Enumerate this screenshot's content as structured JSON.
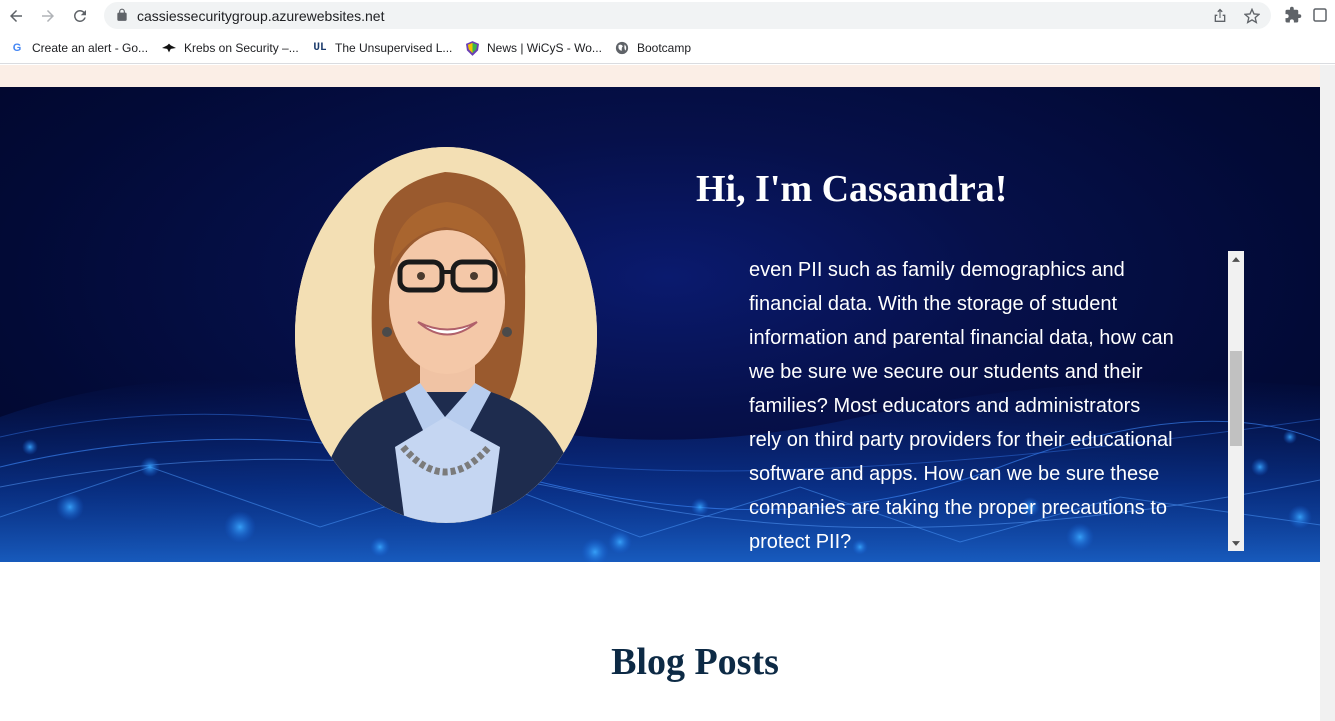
{
  "browser": {
    "url": "cassiessecuritygroup.azurewebsites.net"
  },
  "bookmarks": [
    {
      "label": "Create an alert - Go...",
      "icon": "google-icon"
    },
    {
      "label": "Krebs on Security –...",
      "icon": "krebs-icon"
    },
    {
      "label": "The Unsupervised L...",
      "icon": "unsupervised-learning-icon"
    },
    {
      "label": "News | WiCyS - Wo...",
      "icon": "wicys-shield-icon"
    },
    {
      "label": "Bootcamp",
      "icon": "globe-icon"
    }
  ],
  "hero": {
    "title": "Hi, I'm Cassandra!",
    "lines": [
      "even PII such as family demographics and",
      "financial data. With the storage of student",
      "information and parental financial data, how can",
      "we be sure we secure our students and their",
      "families? Most educators and administrators",
      "rely on third party providers for their educational",
      "software and apps. How can we be sure these",
      "companies are taking the proper precautions to",
      "protect PII?"
    ]
  },
  "blog": {
    "title": "Blog Posts"
  },
  "colors": {
    "hero_bg": "#020a36",
    "cream_strip": "#fbeee6",
    "blog_title": "#0d2a45"
  }
}
